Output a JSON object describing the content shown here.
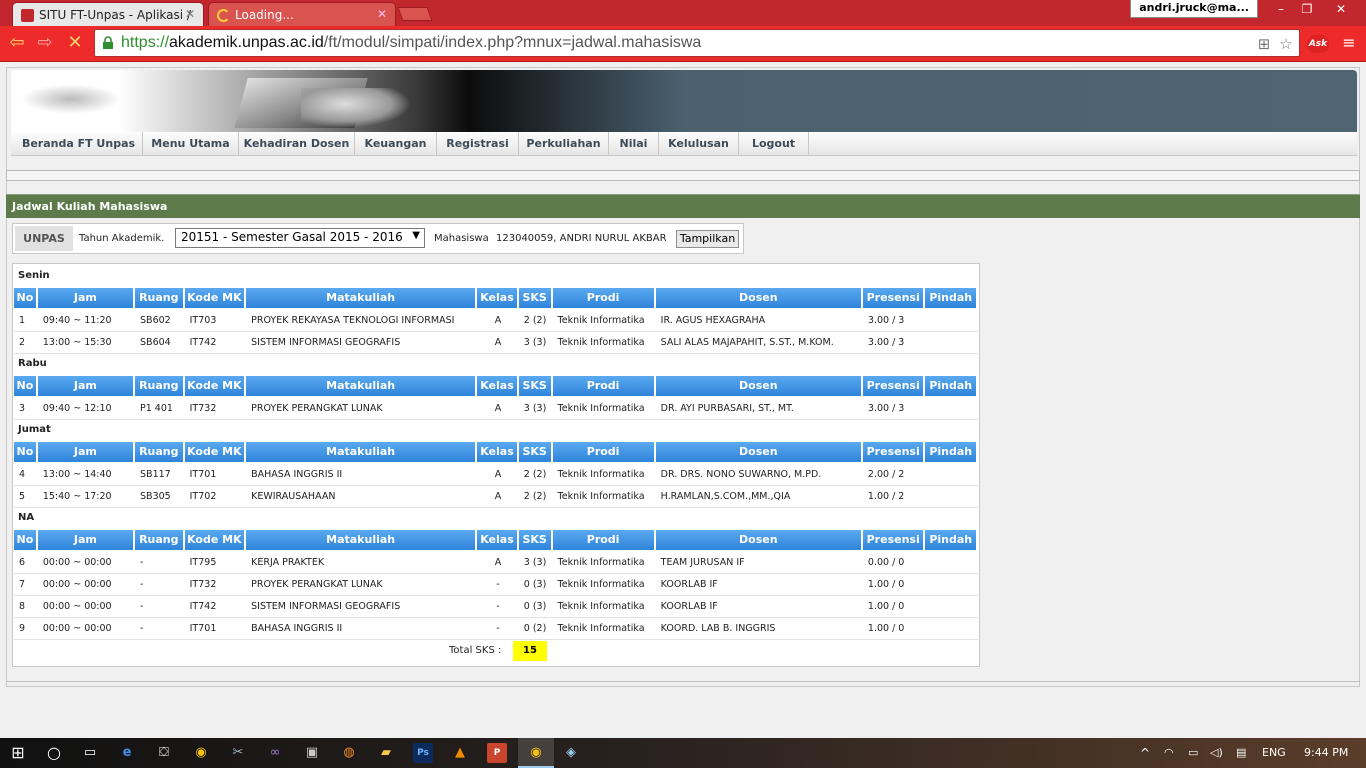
{
  "browser": {
    "tabs": [
      {
        "title": "SITU FT-Unpas - Aplikasi /",
        "state": "active"
      },
      {
        "title": "Loading...",
        "state": "inactive"
      }
    ],
    "user": "andri.jruck@ma...",
    "url_scheme": "https://",
    "url_host": "akademik.unpas.ac.id",
    "url_path": "/ft/modul/simpati/index.php?mnux=jadwal.mahasiswa",
    "ask_label": "Ask",
    "accent_color": "#ee2b2b"
  },
  "menu": {
    "items": [
      "Beranda FT Unpas",
      "Menu Utama",
      "Kehadiran Dosen",
      "Keuangan",
      "Registrasi",
      "Perkuliahan",
      "Nilai",
      "Kelulusan",
      "Logout"
    ]
  },
  "section": {
    "title": "Jadwal Kuliah Mahasiswa"
  },
  "filter": {
    "badge": "UNPAS",
    "year_label": "Tahun Akademik.",
    "year_value": "20151 - Semester Gasal 2015 - 2016",
    "student_label": "Mahasiswa",
    "student_value": "123040059, ANDRI NURUL AKBAR",
    "button": "Tampilkan"
  },
  "table": {
    "headers": [
      "No",
      "Jam",
      "Ruang",
      "Kode MK",
      "Matakuliah",
      "Kelas",
      "SKS",
      "Prodi",
      "Dosen",
      "Presensi",
      "Pindah"
    ],
    "days": [
      {
        "name": "Senin",
        "rows": [
          [
            "1",
            "09:40 ~ 11:20",
            "SB602",
            "IT703",
            "PROYEK REKAYASA TEKNOLOGI INFORMASI",
            "A",
            "2 (2)",
            "Teknik Informatika",
            "IR. AGUS HEXAGRAHA",
            "3.00 / 3",
            ""
          ],
          [
            "2",
            "13:00 ~ 15:30",
            "SB604",
            "IT742",
            "SISTEM INFORMASI GEOGRAFIS",
            "A",
            "3 (3)",
            "Teknik Informatika",
            "SALI ALAS MAJAPAHIT, S.ST., M.KOM.",
            "3.00 / 3",
            ""
          ]
        ]
      },
      {
        "name": "Rabu",
        "rows": [
          [
            "3",
            "09:40 ~ 12:10",
            "P1 401",
            "IT732",
            "PROYEK PERANGKAT LUNAK",
            "A",
            "3 (3)",
            "Teknik Informatika",
            "DR. AYI PURBASARI, ST., MT.",
            "3.00 / 3",
            ""
          ]
        ]
      },
      {
        "name": "Jumat",
        "rows": [
          [
            "4",
            "13:00 ~ 14:40",
            "SB117",
            "IT701",
            "BAHASA INGGRIS II",
            "A",
            "2 (2)",
            "Teknik Informatika",
            "DR. DRS. NONO SUWARNO, M.PD.",
            "2.00 / 2",
            ""
          ],
          [
            "5",
            "15:40 ~ 17:20",
            "SB305",
            "IT702",
            "KEWIRAUSAHAAN",
            "A",
            "2 (2)",
            "Teknik Informatika",
            "H.RAMLAN,S.COM.,MM.,QIA",
            "1.00 / 2",
            ""
          ]
        ]
      },
      {
        "name": "NA",
        "rows": [
          [
            "6",
            "00:00 ~ 00:00",
            "-",
            "IT795",
            "KERJA PRAKTEK",
            "A",
            "3 (3)",
            "Teknik Informatika",
            "TEAM JURUSAN IF",
            "0.00 / 0",
            ""
          ],
          [
            "7",
            "00:00 ~ 00:00",
            "-",
            "IT732",
            "PROYEK PERANGKAT LUNAK",
            "-",
            "0 (3)",
            "Teknik Informatika",
            "KOORLAB IF",
            "1.00 / 0",
            ""
          ],
          [
            "8",
            "00:00 ~ 00:00",
            "-",
            "IT742",
            "SISTEM INFORMASI GEOGRAFIS",
            "-",
            "0 (3)",
            "Teknik Informatika",
            "KOORLAB IF",
            "1.00 / 0",
            ""
          ],
          [
            "9",
            "00:00 ~ 00:00",
            "-",
            "IT701",
            "BAHASA INGGRIS II",
            "-",
            "0 (2)",
            "Teknik Informatika",
            "KOORD. LAB B. INGGRIS",
            "1.00 / 0",
            ""
          ]
        ]
      }
    ],
    "total_label": "Total SKS :",
    "total_value": "15"
  },
  "taskbar": {
    "language": "ENG",
    "time": "9:44 PM"
  }
}
